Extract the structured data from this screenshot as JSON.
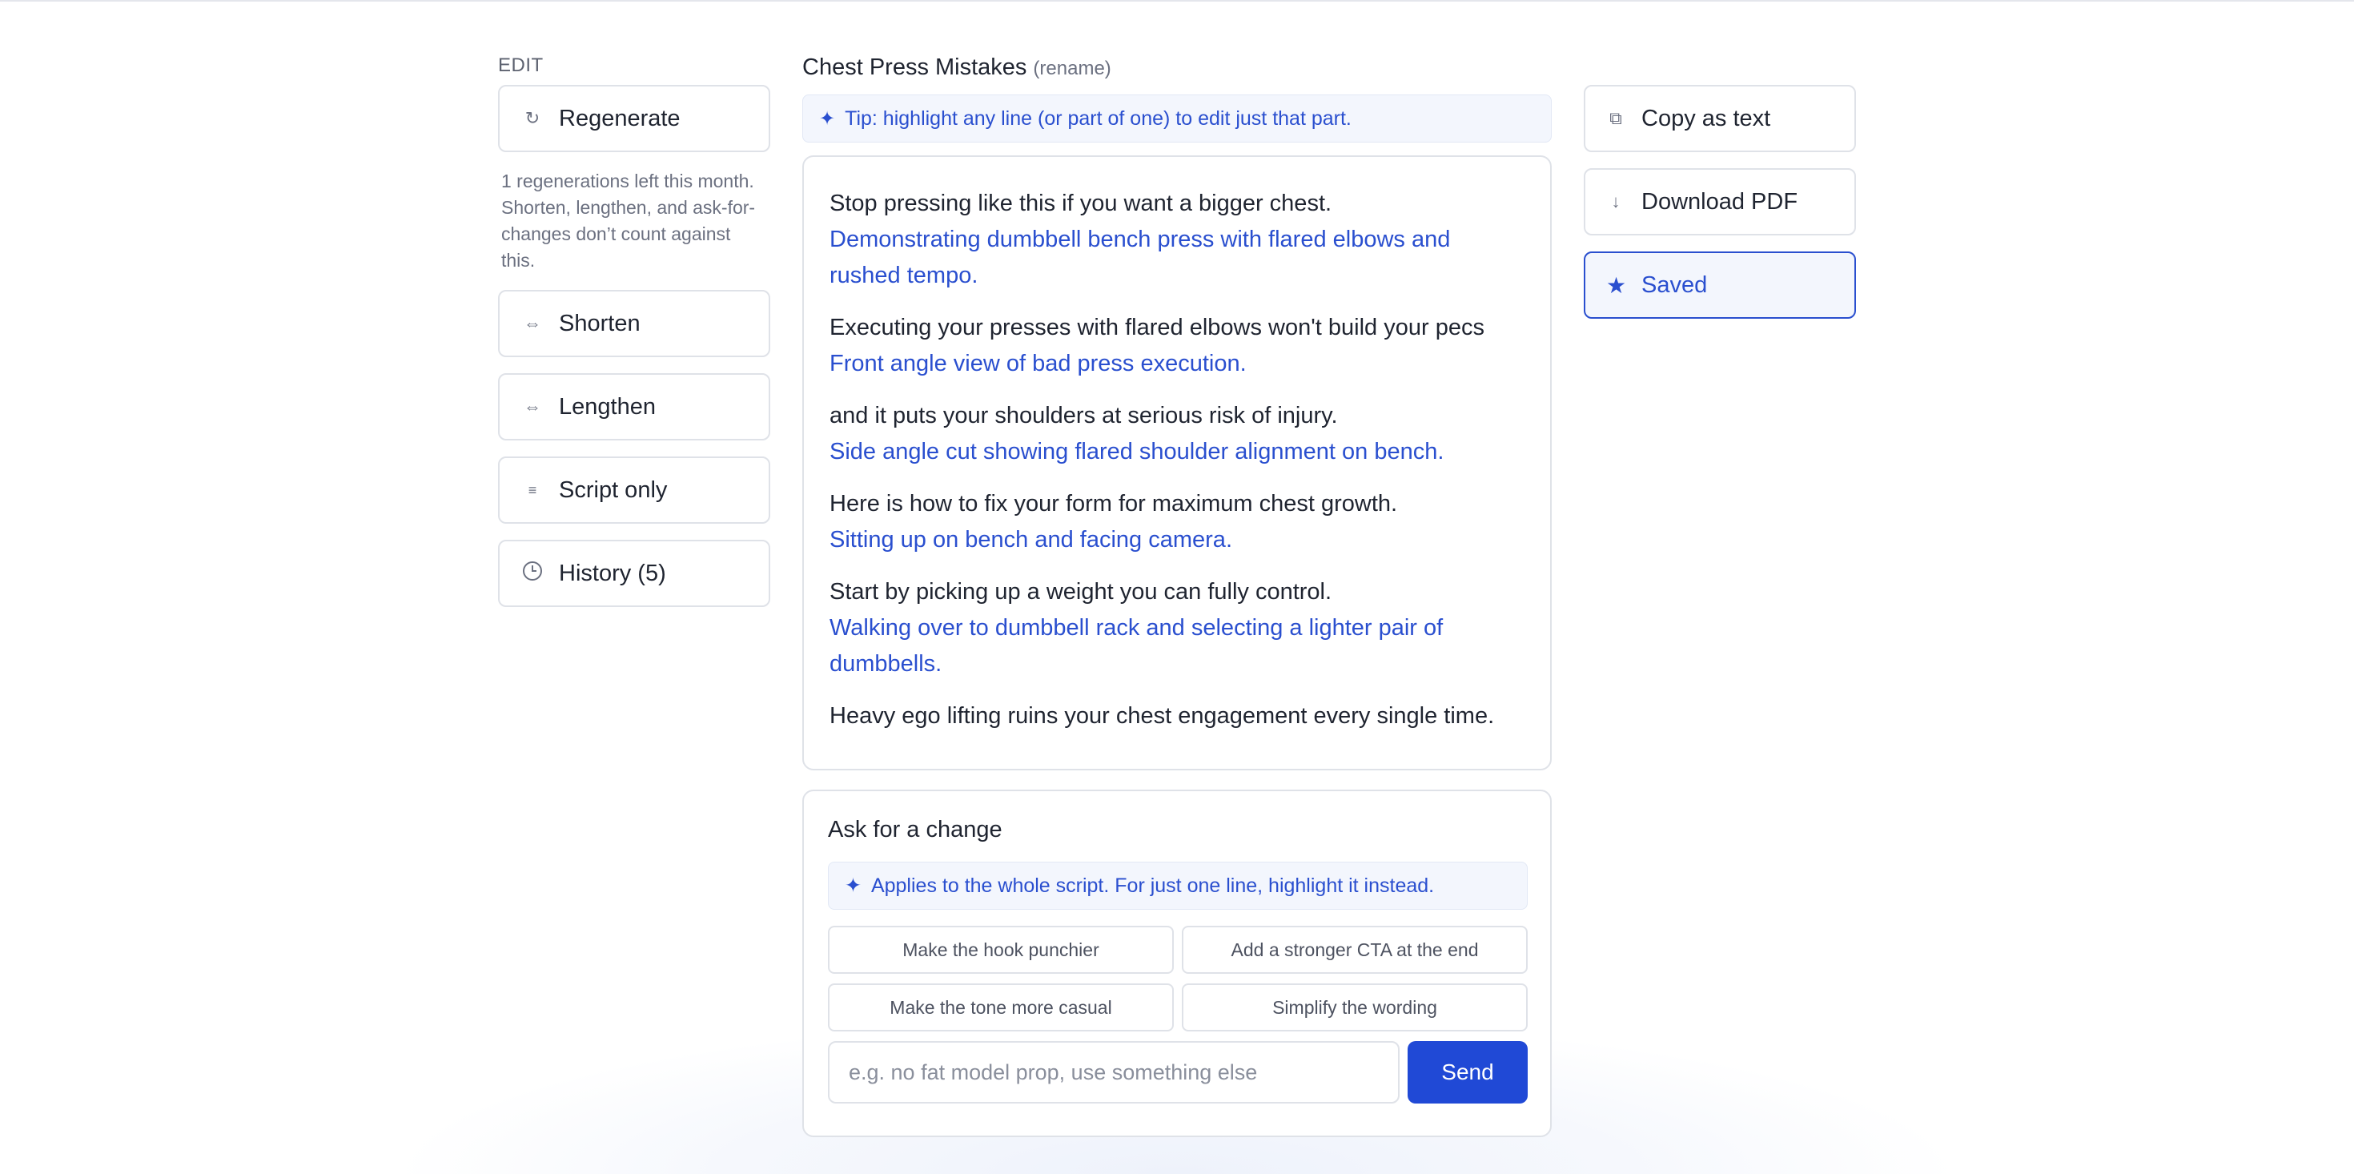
{
  "left": {
    "edit_heading": "EDIT",
    "regenerate": {
      "label": "Regenerate",
      "icon": "refresh-icon"
    },
    "regen_note": "1 regenerations left this month. Shorten, lengthen, and ask-for-changes don’t count against this.",
    "shorten": {
      "label": "Shorten",
      "icon": "arrows-horizontal-icon"
    },
    "lengthen": {
      "label": "Lengthen",
      "icon": "arrows-horizontal-icon"
    },
    "script_only": {
      "label": "Script only",
      "icon": "lines-icon"
    },
    "history": {
      "label": "History (5)",
      "icon": "clock-icon"
    }
  },
  "document": {
    "title": "Chest Press Mistakes",
    "rename_label": "(rename)",
    "tip": "Tip: highlight any line (or part of one) to edit just that part."
  },
  "script": [
    {
      "spoken": "Stop pressing like this if you want a bigger chest.",
      "visual": "Demonstrating dumbbell bench press with flared elbows and rushed tempo."
    },
    {
      "spoken": "Executing your presses with flared elbows won't build your pecs",
      "visual": "Front angle view of bad press execution."
    },
    {
      "spoken": "and it puts your shoulders at serious risk of injury.",
      "visual": "Side angle cut showing flared shoulder alignment on bench."
    },
    {
      "spoken": "Here is how to fix your form for maximum chest growth.",
      "visual": "Sitting up on bench and facing camera."
    },
    {
      "spoken": "Start by picking up a weight you can fully control.",
      "visual": "Walking over to dumbbell rack and selecting a lighter pair of dumbbells."
    },
    {
      "spoken": "Heavy ego lifting ruins your chest engagement every single time.",
      "visual": ""
    }
  ],
  "change": {
    "title": "Ask for a change",
    "note": "Applies to the whole script. For just one line, highlight it instead.",
    "chips": [
      "Make the hook punchier",
      "Add a stronger CTA at the end",
      "Make the tone more casual",
      "Simplify the wording"
    ],
    "input_placeholder": "e.g. no fat model prop, use something else",
    "input_value": "",
    "send_label": "Send"
  },
  "right": {
    "copy": {
      "label": "Copy as text",
      "icon": "copy-icon"
    },
    "download": {
      "label": "Download PDF",
      "icon": "download-arrow-icon"
    },
    "saved": {
      "label": "Saved",
      "icon": "star-icon"
    }
  },
  "colors": {
    "accent": "#2049d6",
    "accent_text": "#2a4fcf",
    "tip_bg": "#f3f6fd",
    "border": "#dfe2e8",
    "text": "#1f2430",
    "muted": "#6b7080"
  }
}
